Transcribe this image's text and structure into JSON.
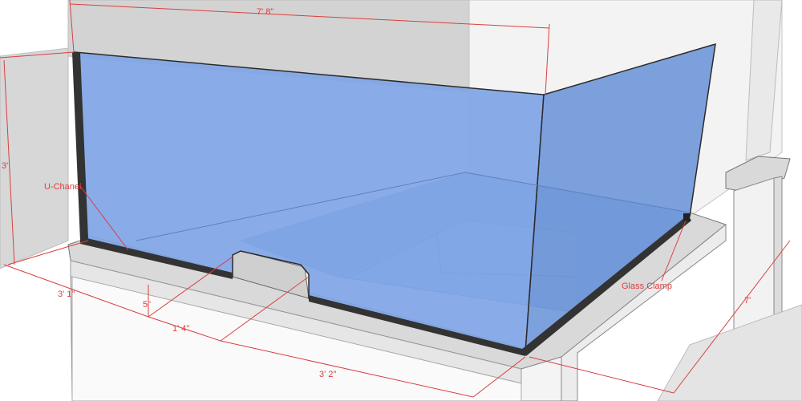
{
  "dimensions": {
    "top_width": "7' 8\"",
    "left_height": "3'",
    "front_left": "3' 1\"",
    "notch_depth": "5\"",
    "notch_width": "1' 4\"",
    "front_right": "3' 2\"",
    "right_depth": "7'"
  },
  "callouts": {
    "u_channel": "U-Chanel",
    "glass_clamp": "Glass Clamp"
  },
  "colors": {
    "glass_front": "#7fa5e6",
    "glass_side": "#6f97d8",
    "dimension_line": "#d94040",
    "wall_light": "#e2e2e2",
    "wall_mid": "#cfcfcf",
    "ledge_top": "#d8d8d8",
    "ledge_face": "#f2f2f2",
    "channel": "#333333"
  }
}
